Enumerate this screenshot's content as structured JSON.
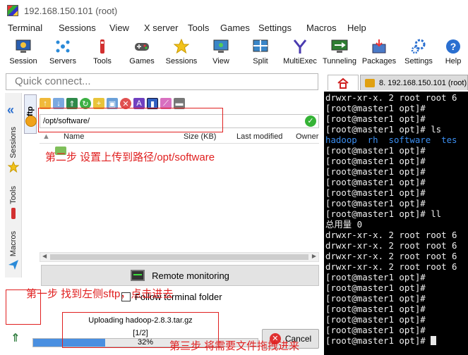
{
  "window": {
    "title": "192.168.150.101 (root)"
  },
  "menu": [
    "Terminal",
    "Sessions",
    "View",
    "X server",
    "Tools",
    "Games",
    "Settings",
    "Macros",
    "Help"
  ],
  "toolbar": [
    {
      "label": "Session",
      "icon": "session-icon"
    },
    {
      "label": "Servers",
      "icon": "servers-icon"
    },
    {
      "label": "Tools",
      "icon": "tools-icon"
    },
    {
      "label": "Games",
      "icon": "games-icon"
    },
    {
      "label": "Sessions",
      "icon": "star-icon"
    },
    {
      "label": "View",
      "icon": "view-icon"
    },
    {
      "label": "Split",
      "icon": "split-icon"
    },
    {
      "label": "MultiExec",
      "icon": "multiexec-icon"
    },
    {
      "label": "Tunneling",
      "icon": "tunneling-icon"
    },
    {
      "label": "Packages",
      "icon": "packages-icon"
    },
    {
      "label": "Settings",
      "icon": "gear-icon"
    },
    {
      "label": "Help",
      "icon": "help-icon"
    }
  ],
  "quick_connect": {
    "placeholder": "Quick connect..."
  },
  "terminal_tab": {
    "label": "8. 192.168.150.101 (root)"
  },
  "side_tabs": [
    {
      "label": "Sessions",
      "icon": "star-icon"
    },
    {
      "label": "Tools",
      "icon": "tools-icon"
    },
    {
      "label": "Macros",
      "icon": "send-icon"
    }
  ],
  "sftp": {
    "tab_label": "Sftp",
    "path": "/opt/software/",
    "columns": [
      "Name",
      "Size (KB)",
      "Last modified",
      "Owner"
    ],
    "remote_monitoring": "Remote monitoring",
    "follow_folder": "Follow terminal folder",
    "follow_checked": false
  },
  "upload": {
    "filename": "Uploading hadoop-2.8.3.tar.gz",
    "count": "[1/2]",
    "percent_text": "32%",
    "progress": 0.32,
    "cancel_label": "Cancel"
  },
  "annotations": {
    "step1": "第一步 找到左侧sftp，点击进去",
    "step2": "第二步 设置上传到路径/opt/software",
    "step3": "第三步 将需要文件拖拽进来"
  },
  "terminal": {
    "lines": [
      {
        "text": "drwxr-xr-x. 2 root root 6",
        "color": "white"
      },
      {
        "text": "[root@master1 opt]#",
        "color": "white"
      },
      {
        "text": "[root@master1 opt]#",
        "color": "white"
      },
      {
        "text": "[root@master1 opt]# ls",
        "color": "white"
      },
      {
        "text": "hadoop  rh  software  tes",
        "color": "blue"
      },
      {
        "text": "[root@master1 opt]#",
        "color": "white"
      },
      {
        "text": "[root@master1 opt]#",
        "color": "white"
      },
      {
        "text": "[root@master1 opt]#",
        "color": "white"
      },
      {
        "text": "[root@master1 opt]#",
        "color": "white"
      },
      {
        "text": "[root@master1 opt]#",
        "color": "white"
      },
      {
        "text": "[root@master1 opt]#",
        "color": "white"
      },
      {
        "text": "[root@master1 opt]# ll",
        "color": "white"
      },
      {
        "text": "总用量 0",
        "color": "white"
      },
      {
        "text": "drwxr-xr-x. 2 root root 6",
        "color": "white"
      },
      {
        "text": "drwxr-xr-x. 2 root root 6",
        "color": "white"
      },
      {
        "text": "drwxr-xr-x. 2 root root 6",
        "color": "white"
      },
      {
        "text": "drwxr-xr-x. 2 root root 6",
        "color": "white"
      },
      {
        "text": "[root@master1 opt]#",
        "color": "white"
      },
      {
        "text": "[root@master1 opt]#",
        "color": "white"
      },
      {
        "text": "[root@master1 opt]#",
        "color": "white"
      },
      {
        "text": "[root@master1 opt]#",
        "color": "white"
      },
      {
        "text": "[root@master1 opt]#",
        "color": "white"
      },
      {
        "text": "[root@master1 opt]#",
        "color": "white"
      },
      {
        "text": "[root@master1 opt]# ",
        "color": "white",
        "cursor": true
      }
    ]
  },
  "colors": {
    "annotation": "#e02020",
    "terminal_bg": "#000000",
    "terminal_blue": "#3b8ef0",
    "progress": "#4a8fe0"
  }
}
